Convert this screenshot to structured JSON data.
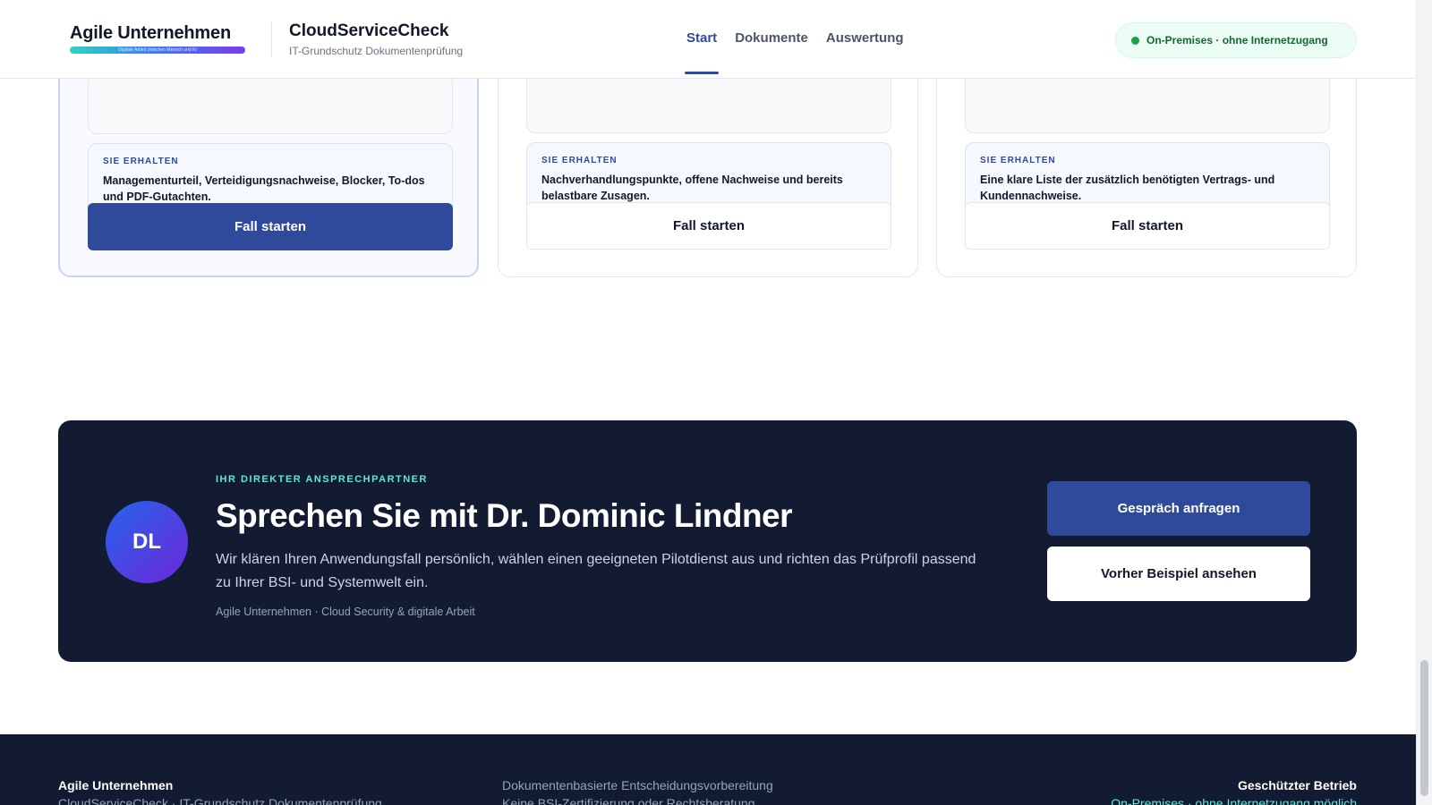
{
  "header": {
    "brand_name": "Agile Unternehmen",
    "brand_tagline": "Digitale Arbeit zwischen Mensch und KI",
    "product_name": "CloudServiceCheck",
    "product_sub": "IT-Grundschutz Dokumentenprüfung",
    "nav": [
      {
        "label": "Start",
        "active": true
      },
      {
        "label": "Dokumente",
        "active": false
      },
      {
        "label": "Auswertung",
        "active": false
      }
    ],
    "status": "On-Premises · ohne Internetzugang"
  },
  "cards": [
    {
      "label": "SIE ERHALTEN",
      "text": "Managementurteil, Verteidigungsnachweise, Blocker, To-dos und PDF-Gutachten.",
      "button": "Fall starten",
      "highlight": true
    },
    {
      "label": "SIE ERHALTEN",
      "text": "Nachverhandlungspunkte, offene Nachweise und bereits belastbare Zusagen.",
      "button": "Fall starten",
      "highlight": false
    },
    {
      "label": "SIE ERHALTEN",
      "text": "Eine klare Liste der zusätzlich benötigten Vertrags- und Kundennachweise.",
      "button": "Fall starten",
      "highlight": false
    }
  ],
  "contact": {
    "eyebrow": "IHR DIREKTER ANSPRECHPARTNER",
    "avatar_initials": "DL",
    "title": "Sprechen Sie mit Dr. Dominic Lindner",
    "description": "Wir klären Ihren Anwendungsfall persönlich, wählen einen geeigneten Pilotdienst aus und richten das Prüfprofil passend zu Ihrer BSI- und Systemwelt ein.",
    "meta": "Agile Unternehmen · Cloud Security & digitale Arbeit",
    "primary_button": "Gespräch anfragen",
    "secondary_button": "Vorher Beispiel ansehen"
  },
  "footer": {
    "col1_title": "Agile Unternehmen",
    "col1_sub": "CloudServiceCheck · IT-Grundschutz Dokumentenprüfung",
    "col2_line1": "Dokumentenbasierte Entscheidungsvorbereitung",
    "col2_line2": "Keine BSI-Zertifizierung oder Rechtsberatung",
    "col3_title": "Geschützter Betrieb",
    "col3_sub": "On-Premises · ohne Internetzugang möglich"
  },
  "colors": {
    "primary": "#2f4a9a",
    "dark": "#131b33",
    "accent_teal": "#5eead4",
    "status_green": "#16a34a"
  }
}
